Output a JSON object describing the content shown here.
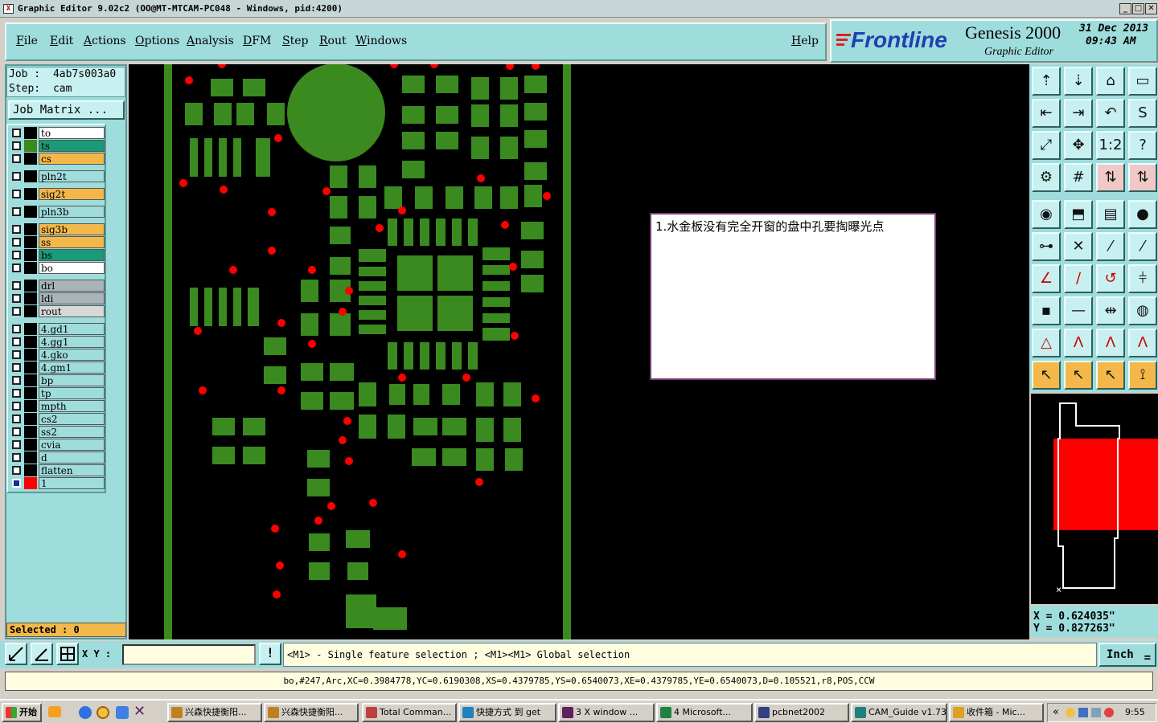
{
  "window": {
    "title": "Graphic Editor 9.02c2 (OO@MT-MTCAM-PC048 - Windows, pid:4200)",
    "minimize": "_",
    "maximize": "□",
    "close": "✕",
    "app_icon": "x-icon"
  },
  "menu": {
    "items": [
      "File",
      "Edit",
      "Actions",
      "Options",
      "Analysis",
      "DFM",
      "Step",
      "Rout",
      "Windows"
    ],
    "help": "Help"
  },
  "logo": {
    "brand": "Frontline",
    "product": "Genesis 2000",
    "subtitle": "Graphic Editor",
    "date": "31 Dec 2013",
    "time": "09:43 AM"
  },
  "job": {
    "job_label": "Job :",
    "job_value": "4ab7s003a0",
    "step_label": "Step:",
    "step_value": "cam",
    "matrix_button": "Job Matrix ..."
  },
  "layers": [
    {
      "name": "to",
      "color": "#ffffff",
      "group": 0
    },
    {
      "name": "ts",
      "color": "#1a9a78",
      "group": 0,
      "swatch": "#3a8a20"
    },
    {
      "name": "cs",
      "color": "#f4b84a",
      "group": 0
    },
    {
      "name": "pln2t",
      "color": "#9fdcdc",
      "group": 1
    },
    {
      "name": "sig2t",
      "color": "#f4b84a",
      "group": 2
    },
    {
      "name": "pln3b",
      "color": "#9fdcdc",
      "group": 3
    },
    {
      "name": "sig3b",
      "color": "#f4b84a",
      "group": 4
    },
    {
      "name": "ss",
      "color": "#f4b84a",
      "group": 4
    },
    {
      "name": "bs",
      "color": "#1a9a78",
      "group": 4
    },
    {
      "name": "bo",
      "color": "#ffffff",
      "group": 4
    },
    {
      "name": "drl",
      "color": "#a8b4b8",
      "group": 5
    },
    {
      "name": "ldi",
      "color": "#a8b4b8",
      "group": 5
    },
    {
      "name": "rout",
      "color": "#d8d8d8",
      "group": 5
    },
    {
      "name": "4.gd1",
      "color": "#9fdcdc",
      "group": 6
    },
    {
      "name": "4.gg1",
      "color": "#9fdcdc",
      "group": 6
    },
    {
      "name": "4.gko",
      "color": "#9fdcdc",
      "group": 6
    },
    {
      "name": "4.gm1",
      "color": "#9fdcdc",
      "group": 6
    },
    {
      "name": "bp",
      "color": "#9fdcdc",
      "group": 6
    },
    {
      "name": "tp",
      "color": "#9fdcdc",
      "group": 6
    },
    {
      "name": "mpth",
      "color": "#9fdcdc",
      "group": 6
    },
    {
      "name": "cs2",
      "color": "#9fdcdc",
      "group": 6
    },
    {
      "name": "ss2",
      "color": "#9fdcdc",
      "group": 6
    },
    {
      "name": "cvia",
      "color": "#9fdcdc",
      "group": 6
    },
    {
      "name": "d",
      "color": "#9fdcdc",
      "group": 6
    },
    {
      "name": "flatten",
      "color": "#9fdcdc",
      "group": 6
    },
    {
      "name": "1",
      "color": "#9fdcdc",
      "group": 6,
      "swatch": "#ff0000",
      "active": true
    }
  ],
  "selected": "Selected : 0",
  "comment": "1.水金板没有完全开窗的盘中孔要掏曝光点",
  "tools": [
    "edit-up-icon",
    "edit-down-icon",
    "home-icon",
    "window-icon",
    "pan-left-icon",
    "pan-right-icon",
    "undo-icon",
    "s-curve-icon",
    "zoom-fit-icon",
    "zoom-center-icon",
    "one-to-two-icon",
    "help-icon",
    "snap-icon",
    "grid-icon",
    "layers-red-icon",
    "layers-red-2-icon",
    "pad-icon",
    "redraw-icon",
    "ruler-icon",
    "circle-icon",
    "connect-icon",
    "cross-icon",
    "line-dot-icon",
    "line-dot-2-icon",
    "angle-icon",
    "slash-icon",
    "arc-icon",
    "mirror-icon",
    "shapes-icon",
    "minus-icon",
    "resize-icon",
    "circles-icon",
    "triangle-icon",
    "triangle-a-icon",
    "triangle-a-2-icon",
    "triangle-a-3-icon",
    "pointer-icon",
    "pointer-box-icon",
    "pointer-circle-icon",
    "pointer-steps-icon"
  ],
  "coords": {
    "x": "X  =  0.624035\"",
    "y": "Y  =  0.827263\""
  },
  "status": {
    "xy_label": "X Y :",
    "xy_value": "",
    "bang": "!",
    "message": "<M1> - Single feature selection ; <M1><M1> Global selection",
    "unit": "Inch"
  },
  "info": "bo,#247,Arc,XC=0.3984778,YC=0.6190308,XS=0.4379785,YS=0.6540073,XE=0.4379785,YE=0.6540073,D=0.105521,r8,POS,CCW",
  "taskbar": {
    "start": "开始",
    "tasks": [
      "兴森快捷衡阳...",
      "兴森快捷衡阳...",
      "Total Comman...",
      "快捷方式 到 get",
      "3 X window ...",
      "4 Microsoft...",
      "pcbnet2002",
      "CAM_Guide v1.73",
      "收件箱 - Mic..."
    ],
    "clock": "9:55",
    "tray_arrow": "«"
  },
  "colors": {
    "panel": "#9fdcdc",
    "pad": "#3a8a20",
    "hole": "#ff0000",
    "canvas": "#000000"
  }
}
